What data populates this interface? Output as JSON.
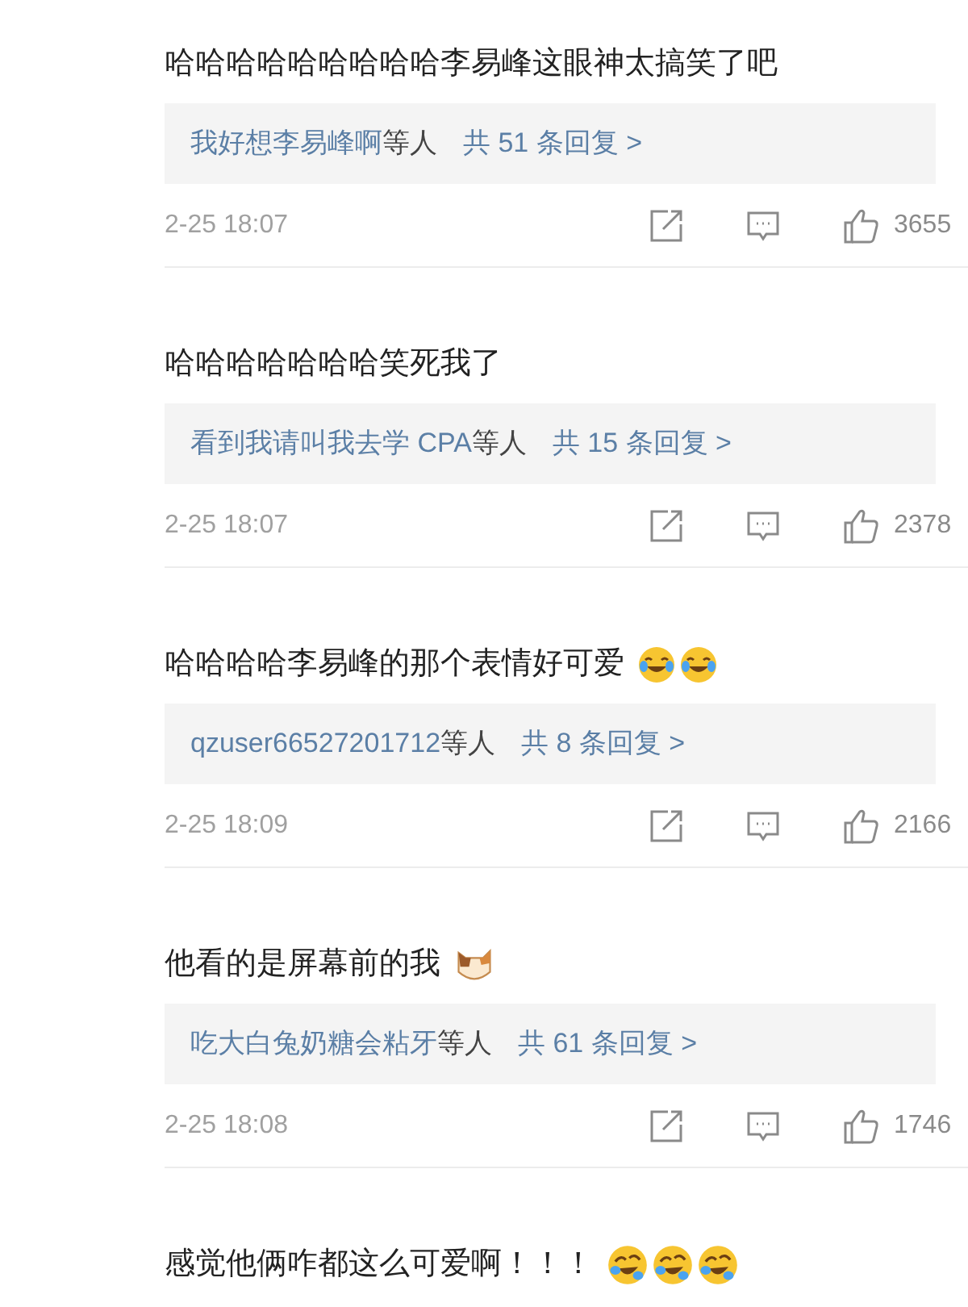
{
  "comments": [
    {
      "text": "哈哈哈哈哈哈哈哈哈李易峰这眼神太搞笑了吧",
      "replies": {
        "names": "我好想李易峰啊",
        "others": "等人",
        "count": "共 51 条回复 >"
      },
      "time": "2-25 18:07",
      "likes": "3655"
    },
    {
      "text": "哈哈哈哈哈哈哈笑死我了",
      "replies": {
        "names": "看到我请叫我去学 CPA",
        "others": "等人",
        "count": "共 15 条回复 >"
      },
      "time": "2-25 18:07",
      "likes": "2378"
    },
    {
      "text": "哈哈哈哈李易峰的那个表情好可爱",
      "emojis": [
        {
          "kind": "grin_tears"
        },
        {
          "kind": "grin_tears"
        }
      ],
      "replies": {
        "names": "qzuser66527201712",
        "others": "等人",
        "count": "共 8 条回复 >"
      },
      "time": "2-25 18:09",
      "likes": "2166"
    },
    {
      "text": "他看的是屏幕前的我",
      "emojis": [
        {
          "kind": "cat"
        }
      ],
      "replies": {
        "names": "吃大白兔奶糖会粘牙",
        "others": "等人",
        "count": "共 61 条回复 >"
      },
      "time": "2-25 18:08",
      "likes": "1746"
    },
    {
      "text": "感觉他俩咋都这么可爱啊！！！",
      "emojis": [
        {
          "kind": "rolling_tears"
        },
        {
          "kind": "rolling_tears"
        },
        {
          "kind": "rolling_tears"
        }
      ]
    }
  ]
}
